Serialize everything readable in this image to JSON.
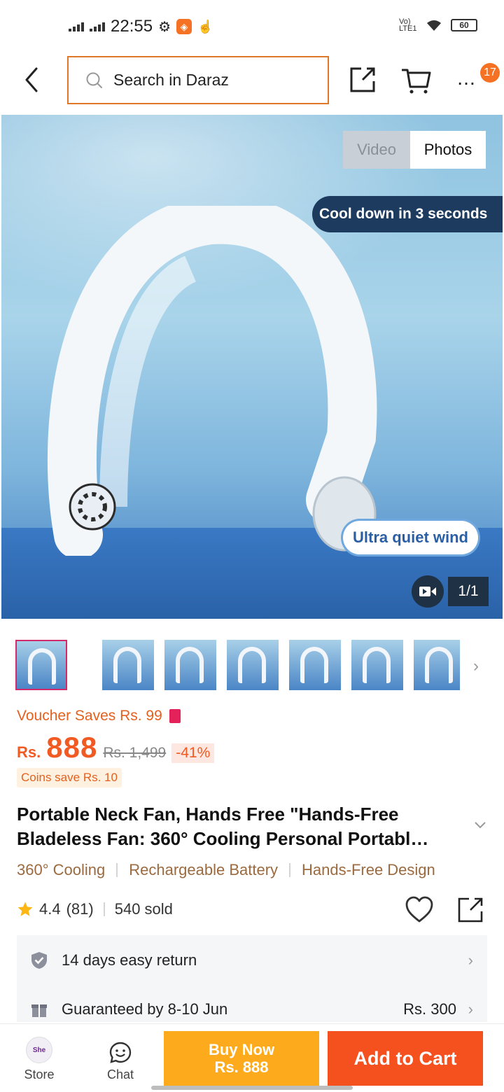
{
  "status_bar": {
    "time": "22:55",
    "network": "Vo) LTE1",
    "battery": "60"
  },
  "top_nav": {
    "search_placeholder": "Search in Daraz",
    "more_badge": "17"
  },
  "gallery": {
    "toggle_video": "Video",
    "toggle_photos": "Photos",
    "selected_toggle": "Photos",
    "overlay_top": "Cool down in 3 seconds",
    "overlay_bottom": "Ultra quiet wind",
    "counter": "1/1",
    "thumbnail_count": 8
  },
  "pricing": {
    "voucher": "Voucher Saves Rs. 99",
    "currency": "Rs.",
    "price": "888",
    "original_price": "Rs. 1,499",
    "discount": "-41%",
    "coins": "Coins save Rs. 10"
  },
  "product": {
    "title": "Portable Neck Fan, Hands Free \"Hands-Free Bladeless Fan: 360° Cooling Personal Portabl…",
    "features": [
      "360° Cooling",
      "Rechargeable Battery",
      "Hands-Free Design"
    ],
    "rating": "4.4",
    "reviews": "(81)",
    "sold": "540 sold"
  },
  "services": [
    {
      "icon": "shield-check-icon",
      "label": "14 days easy return",
      "value": ""
    },
    {
      "icon": "gift-icon",
      "label": "Guaranteed by 8-10 Jun",
      "value": "Rs. 300"
    }
  ],
  "bottom_bar": {
    "store_label": "Store",
    "store_logo_text": "She",
    "chat_label": "Chat",
    "buy_now_label": "Buy Now",
    "buy_now_price": "Rs. 888",
    "add_to_cart_label": "Add to Cart"
  },
  "colors": {
    "brand_orange": "#f15a22",
    "buy_now": "#fdab1c",
    "add_to_cart": "#f5511f",
    "feature_brown": "#9b6a3e"
  }
}
